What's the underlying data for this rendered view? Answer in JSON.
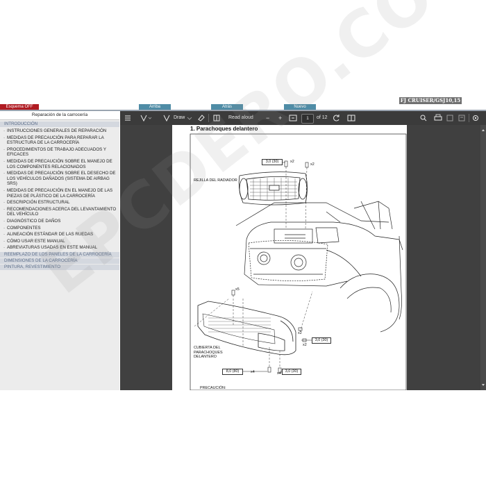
{
  "header": {
    "model": "FJ CRUISER/GSJ10,15",
    "buttons": [
      {
        "label": "Esquema OFF",
        "color": "#b01b22"
      },
      {
        "label": "Arriba",
        "color": "#4f8ca6"
      },
      {
        "label": "Atrás",
        "color": "#4f8ca6"
      },
      {
        "label": "Nuevo",
        "color": "#4f8ca6"
      }
    ]
  },
  "sidebar": {
    "title": "Reparación de la carrocería",
    "section_intro": "INTRODUCCIÓN",
    "items": [
      "INSTRUCCIONES GENERALES DE REPARACIÓN",
      "MEDIDAS DE PRECAUCIÓN PARA REPARAR LA ESTRUCTURA DE LA CARROCERÍA",
      "PROCEDIMIENTOS DE TRABAJO ADECUADOS Y EFICACES",
      "MEDIDAS DE PRECAUCIÓN SOBRE EL MANEJO DE LOS COMPONENTES RELACIONADOS",
      "MEDIDAS DE PRECAUCIÓN SOBRE EL DESECHO DE LOS VEHÍCULOS DAÑADOS (SISTEMA DE AIRBAG SRS)",
      "MEDIDAS DE PRECAUCIÓN EN EL MANEJO DE LAS PIEZAS DE PLÁSTICO DE LA CARROCERÍA",
      "DESCRIPCIÓN ESTRUCTURAL",
      "RECOMENDACIONES ACERCA DEL LEVANTAMIENTO DEL VEHÍCULO",
      "DIAGNÓSTICO DE DAÑOS",
      "COMPONENTES",
      "ALINEACIÓN ESTÁNDAR DE LAS RUEDAS",
      "CÓMO USAR ESTE MANUAL",
      "ABREVIATURAS USADAS EN ESTE MANUAL"
    ],
    "sections": [
      "REEMPLAZO DE LOS PANELES DE LA CARROCERÍA",
      "DIMENSIONES DE LA CARROCERÍA",
      "PINTURA, REVESTIMIENTO"
    ]
  },
  "toolbar": {
    "draw_label": "Draw",
    "read_aloud_label": "Read aloud",
    "minus": "−",
    "plus": "+",
    "page_current": "1",
    "page_total": "of 12"
  },
  "document": {
    "title": "1.   Parachoques delantero",
    "labels": {
      "grille": "REJILLA DEL RADIADOR",
      "cover": "CUBIERTA DEL PARACHOQUES DELANTERO",
      "caution": "PRECAUCIÓN:"
    },
    "specs": [
      "3,0 (30)",
      "3,0 (30)",
      "8,0 (80)",
      "3,0 (30)"
    ],
    "qty": [
      "x2",
      "x2",
      "x5",
      "x2",
      "x2",
      "x4",
      "x4"
    ]
  },
  "watermark": "EPCDERO.COM"
}
